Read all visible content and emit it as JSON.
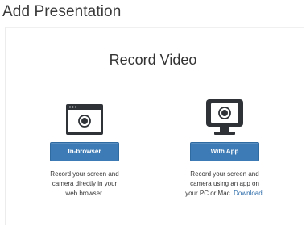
{
  "header": {
    "title": "Add Presentation"
  },
  "main": {
    "section_title": "Record Video",
    "options": [
      {
        "icon": "browser-window-record-icon",
        "button_label": "In-browser",
        "desc_line1": "Record your screen and",
        "desc_line2": "camera directly in your",
        "desc_line3": "web browser."
      },
      {
        "icon": "monitor-record-icon",
        "button_label": "With App",
        "desc_line1": "Record your screen and",
        "desc_line2": "camera using an app on",
        "desc_line3_prefix": "your PC or Mac.",
        "desc_link": "Download."
      }
    ]
  },
  "colors": {
    "accent": "#3d7bb6",
    "icon": "#2f3338",
    "link": "#2a6aa8"
  }
}
